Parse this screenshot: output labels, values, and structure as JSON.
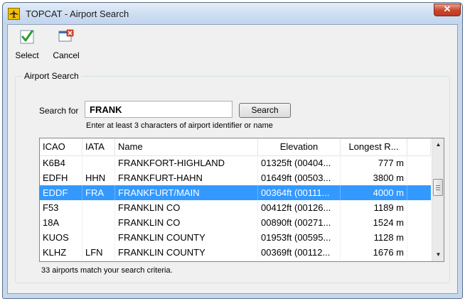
{
  "window": {
    "title": "TOPCAT - Airport Search",
    "close_symbol": "✕"
  },
  "toolbar": {
    "select_label": "Select",
    "cancel_label": "Cancel"
  },
  "search": {
    "group_title": "Airport Search",
    "label": "Search for",
    "value": "FRANK",
    "button_label": "Search",
    "hint": "Enter at least 3 characters of airport identifier or name"
  },
  "grid": {
    "columns": [
      "ICAO",
      "IATA",
      "Name",
      "Elevation",
      "Longest R..."
    ],
    "rows": [
      {
        "icao": "K6B4",
        "iata": "",
        "name": "FRANKFORT-HIGHLAND",
        "elevation": "01325ft (00404...",
        "longest": "777 m"
      },
      {
        "icao": "EDFH",
        "iata": "HHN",
        "name": "FRANKFURT-HAHN",
        "elevation": "01649ft (00503...",
        "longest": "3800 m"
      },
      {
        "icao": "EDDF",
        "iata": "FRA",
        "name": "FRANKFURT/MAIN",
        "elevation": "00364ft (00111...",
        "longest": "4000 m"
      },
      {
        "icao": "F53",
        "iata": "",
        "name": "FRANKLIN CO",
        "elevation": "00412ft (00126...",
        "longest": "1189 m"
      },
      {
        "icao": "18A",
        "iata": "",
        "name": "FRANKLIN CO",
        "elevation": "00890ft (00271...",
        "longest": "1524 m"
      },
      {
        "icao": "KUOS",
        "iata": "",
        "name": "FRANKLIN COUNTY",
        "elevation": "01953ft (00595...",
        "longest": "1128 m"
      },
      {
        "icao": "KLHZ",
        "iata": "LFN",
        "name": "FRANKLIN COUNTY",
        "elevation": "00369ft (00112...",
        "longest": "1676 m"
      }
    ],
    "selected_index": 2
  },
  "status": {
    "text": "33 airports match your search criteria."
  },
  "colors": {
    "selection": "#3399ff",
    "title_bar": "#cfdff2"
  },
  "icons": [
    "plane-icon",
    "checkmark-icon",
    "cancel-icon",
    "close-icon",
    "scroll-up-icon",
    "scroll-down-icon"
  ]
}
